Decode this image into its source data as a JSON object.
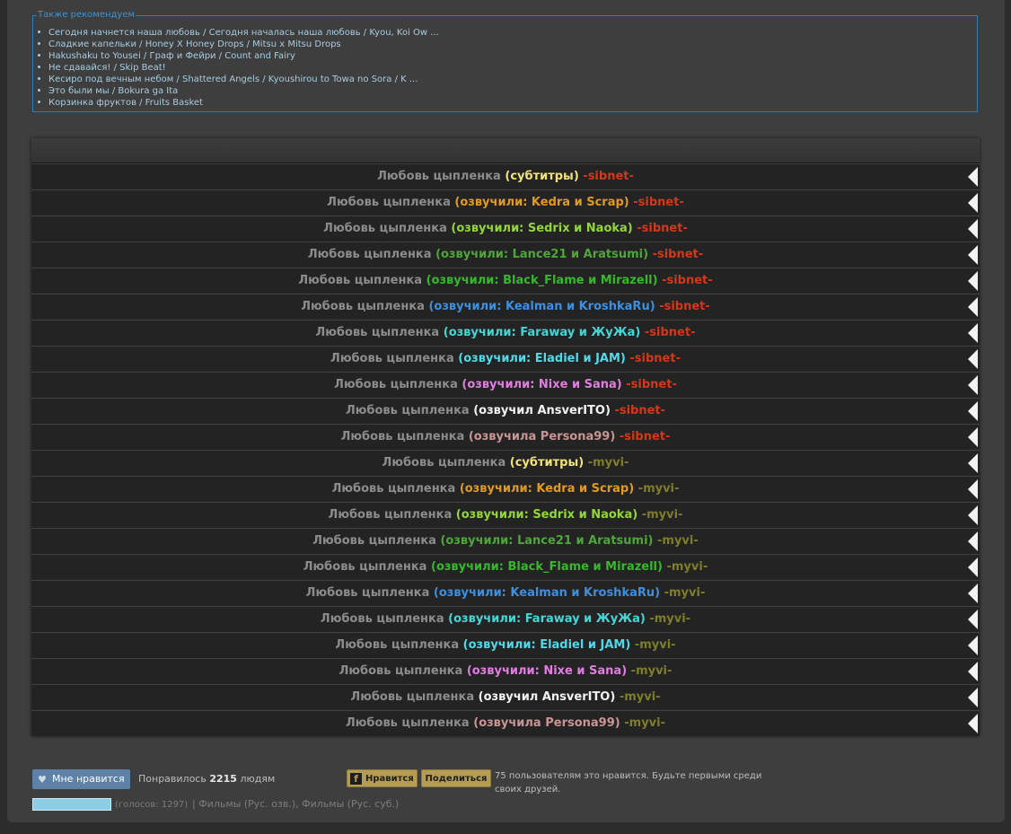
{
  "recommend": {
    "legend": "Также рекомендуем",
    "items": [
      "Сегодня начнется наша любовь / Сегодня началась наша любовь / Kyou, Koi Ow ...",
      "Сладкие капельки / Honey X Honey Drops / Mitsu x Mitsu Drops",
      "Hakushaku to Yousei / Граф и Фейри / Count and Fairy",
      "Не сдавайся! / Skip Beat!",
      "Кесиро под вечным небом / Shattered Angels / Kyoushirou to Towa no Sora / K ...",
      "Это были мы / Bokura ga Ita",
      "Корзинка фруктов / Fruits Basket"
    ]
  },
  "player": {
    "title_text": "Любовь цыпленка",
    "episodes": [
      {
        "voice": "(субтитры)",
        "voice_color": "#f0e27a",
        "source": "-sibnet-",
        "source_color": "#d2381a"
      },
      {
        "voice": "(озвучили: Kedra и Scrap)",
        "voice_color": "#e09a22",
        "source": "-sibnet-",
        "source_color": "#d2381a"
      },
      {
        "voice": "(озвучили: Sedrix и Naoka)",
        "voice_color": "#93d63a",
        "source": "-sibnet-",
        "source_color": "#d2381a"
      },
      {
        "voice": "(озвучили: Lance21 и Aratsumi)",
        "voice_color": "#4ea63a",
        "source": "-sibnet-",
        "source_color": "#d2381a"
      },
      {
        "voice": "(озвучили: Black_Flame и Mirazell)",
        "voice_color": "#37b82c",
        "source": "-sibnet-",
        "source_color": "#d2381a"
      },
      {
        "voice": "(озвучили: Kealman и KroshkaRu)",
        "voice_color": "#3d8fe0",
        "source": "-sibnet-",
        "source_color": "#d2381a"
      },
      {
        "voice": "(озвучили: Faraway и ЖуЖа)",
        "voice_color": "#43d6d6",
        "source": "-sibnet-",
        "source_color": "#d2381a"
      },
      {
        "voice": "(озвучили: Eladiel и JAM)",
        "voice_color": "#52d8e8",
        "source": "-sibnet-",
        "source_color": "#d2381a"
      },
      {
        "voice": "(озвучили: Nixe и Sana)",
        "voice_color": "#e07ee0",
        "source": "-sibnet-",
        "source_color": "#d2381a"
      },
      {
        "voice": "(озвучил AnsverITO)",
        "voice_color": "#f2f2f2",
        "source": "-sibnet-",
        "source_color": "#d2381a"
      },
      {
        "voice": "(озвучила Persona99)",
        "voice_color": "#c99494",
        "source": "-sibnet-",
        "source_color": "#d2381a"
      },
      {
        "voice": "(субтитры)",
        "voice_color": "#f0e27a",
        "source": "-myvi-",
        "source_color": "#7e7e2a"
      },
      {
        "voice": "(озвучили: Kedra и Scrap)",
        "voice_color": "#e09a22",
        "source": "-myvi-",
        "source_color": "#7e7e2a"
      },
      {
        "voice": "(озвучили: Sedrix и Naoka)",
        "voice_color": "#93d63a",
        "source": "-myvi-",
        "source_color": "#7e7e2a"
      },
      {
        "voice": "(озвучили: Lance21 и Aratsumi)",
        "voice_color": "#4ea63a",
        "source": "-myvi-",
        "source_color": "#7e7e2a"
      },
      {
        "voice": "(озвучили: Black_Flame и Mirazell)",
        "voice_color": "#37b82c",
        "source": "-myvi-",
        "source_color": "#7e7e2a"
      },
      {
        "voice": "(озвучили: Kealman и KroshkaRu)",
        "voice_color": "#3d8fe0",
        "source": "-myvi-",
        "source_color": "#7e7e2a"
      },
      {
        "voice": "(озвучили: Faraway и ЖуЖа)",
        "voice_color": "#43d6d6",
        "source": "-myvi-",
        "source_color": "#7e7e2a"
      },
      {
        "voice": "(озвучили: Eladiel и JAM)",
        "voice_color": "#52d8e8",
        "source": "-myvi-",
        "source_color": "#7e7e2a"
      },
      {
        "voice": "(озвучили: Nixe и Sana)",
        "voice_color": "#e07ee0",
        "source": "-myvi-",
        "source_color": "#7e7e2a"
      },
      {
        "voice": "(озвучил AnsverITO)",
        "voice_color": "#f2f2f2",
        "source": "-myvi-",
        "source_color": "#7e7e2a"
      },
      {
        "voice": "(озвучила Persona99)",
        "voice_color": "#c99494",
        "source": "-myvi-",
        "source_color": "#7e7e2a"
      }
    ],
    "play_icon": "triangle-left-icon"
  },
  "social": {
    "vk_like_label": "Мне нравится",
    "vk_like_icon": "heart-icon",
    "liked_prefix": "Понравилось",
    "liked_count": "2215",
    "liked_suffix": "людям",
    "fb_icon": "facebook-icon",
    "fb_like_label": "Нравится",
    "fb_share_label": "Поделиться",
    "fb_text": "75 пользователям это нравится. Будьте первыми среди своих друзей."
  },
  "rating": {
    "fill": 1.0,
    "votes_text": "(голосов: 1297)",
    "categories_text": "| Фильмы (Рус. озв.), Фильмы (Рус. суб.)"
  }
}
